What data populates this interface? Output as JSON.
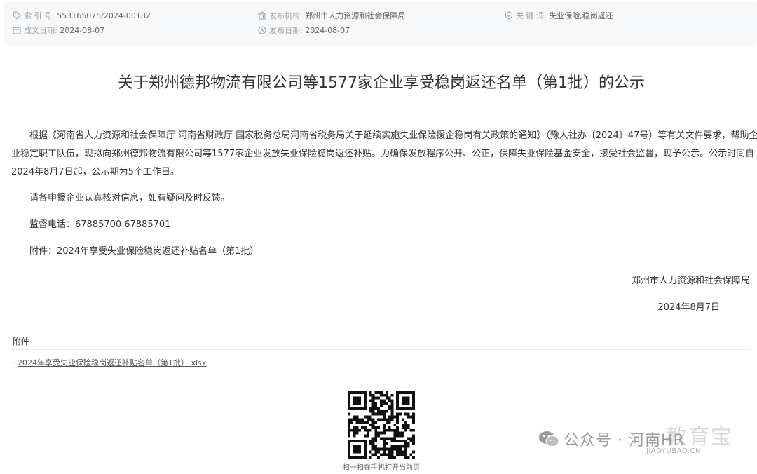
{
  "meta": {
    "index_label": "索 引 号:",
    "index_value": "553165075/2024-00182",
    "org_label": "发布机构:",
    "org_value": "郑州市人力资源和社会保障局",
    "keyword_label": "关 键 词:",
    "keyword_value": "失业保险,稳岗返还",
    "created_label": "成文日期:",
    "created_value": "2024-08-07",
    "published_label": "发布日期:",
    "published_value": "2024-08-07"
  },
  "article": {
    "title": "关于郑州德邦物流有限公司等1577家企业享受稳岗返还名单（第1批）的公示",
    "para1_line1": "根据《河南省人力资源和社会保障厅 河南省财政厅 国家税务总局河南省税务局关于延续实施失业保险援企稳岗有关政策的通知》（豫人社办〔2024〕47号）等有关文件要求，帮助企",
    "para1_line2": "业稳定职工队伍，现拟向郑州德邦物流有限公司等1577家企业发放失业保险稳岗返还补贴。为确保发放程序公开、公正，保障失业保险基金安全，接受社会监督，现予公示。公示时间自",
    "para1_line3": "2024年8月7日起，公示期为5个工作日。",
    "para2": "请各申报企业认真核对信息，如有疑问及时反馈。",
    "para3": "监督电话：67885700 67885701",
    "para4": "附件：2024年享受失业保险稳岗返还补贴名单（第1批）",
    "signature": "郑州市人力资源和社会保障局",
    "date": "2024年8月7日"
  },
  "attachments": {
    "heading": "附件",
    "bullet": "·",
    "file": "2024年享受失业保险稳岗返还补贴名单（第1批）.xlsx"
  },
  "qr": {
    "caption": "扫一扫在手机打开当前页"
  },
  "watermark": {
    "text": "公众号 · 河南HR",
    "big": "教育宝",
    "url": "JIAOYUBAO.CN"
  },
  "colors": {
    "meta_bg": "#f7f8fa",
    "icon": "#9aa5b8",
    "text": "#333333"
  }
}
